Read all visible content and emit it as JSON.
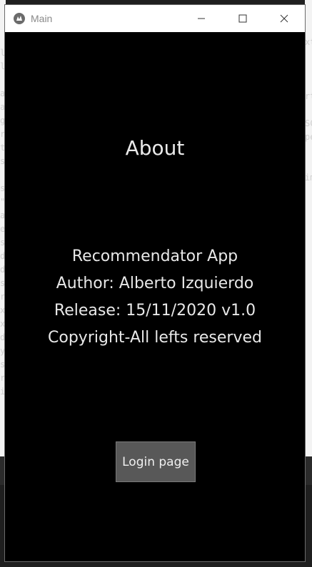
{
  "window": {
    "title": "Main",
    "app_icon": "kivy-icon",
    "controls": {
      "minimize": "minimize-icon",
      "maximize": "maximize-icon",
      "close": "close-icon"
    }
  },
  "main": {
    "heading": "About",
    "info_lines": [
      "Recommendator App",
      "Author: Alberto Izquierdo",
      "Release: 15/11/2020 v1.0",
      "Copyright-All lefts reserved"
    ],
    "login_button": "Login page"
  },
  "background": {
    "left_chars": "l\nl\n\na\na\ng\nr\nt\ns\n\ns\n\"\na\ne\ns\nd\nd\ns\nr\nx\nx\nd\ny\ns\nr\ni",
    "right_chars": "xt\n\n\n\nrt\n\nSC\npe\n\n\nim"
  },
  "colors": {
    "window_bg": "#000000",
    "titlebar_bg": "#ffffff",
    "button_bg": "#585858",
    "text": "#e8e8e8"
  }
}
